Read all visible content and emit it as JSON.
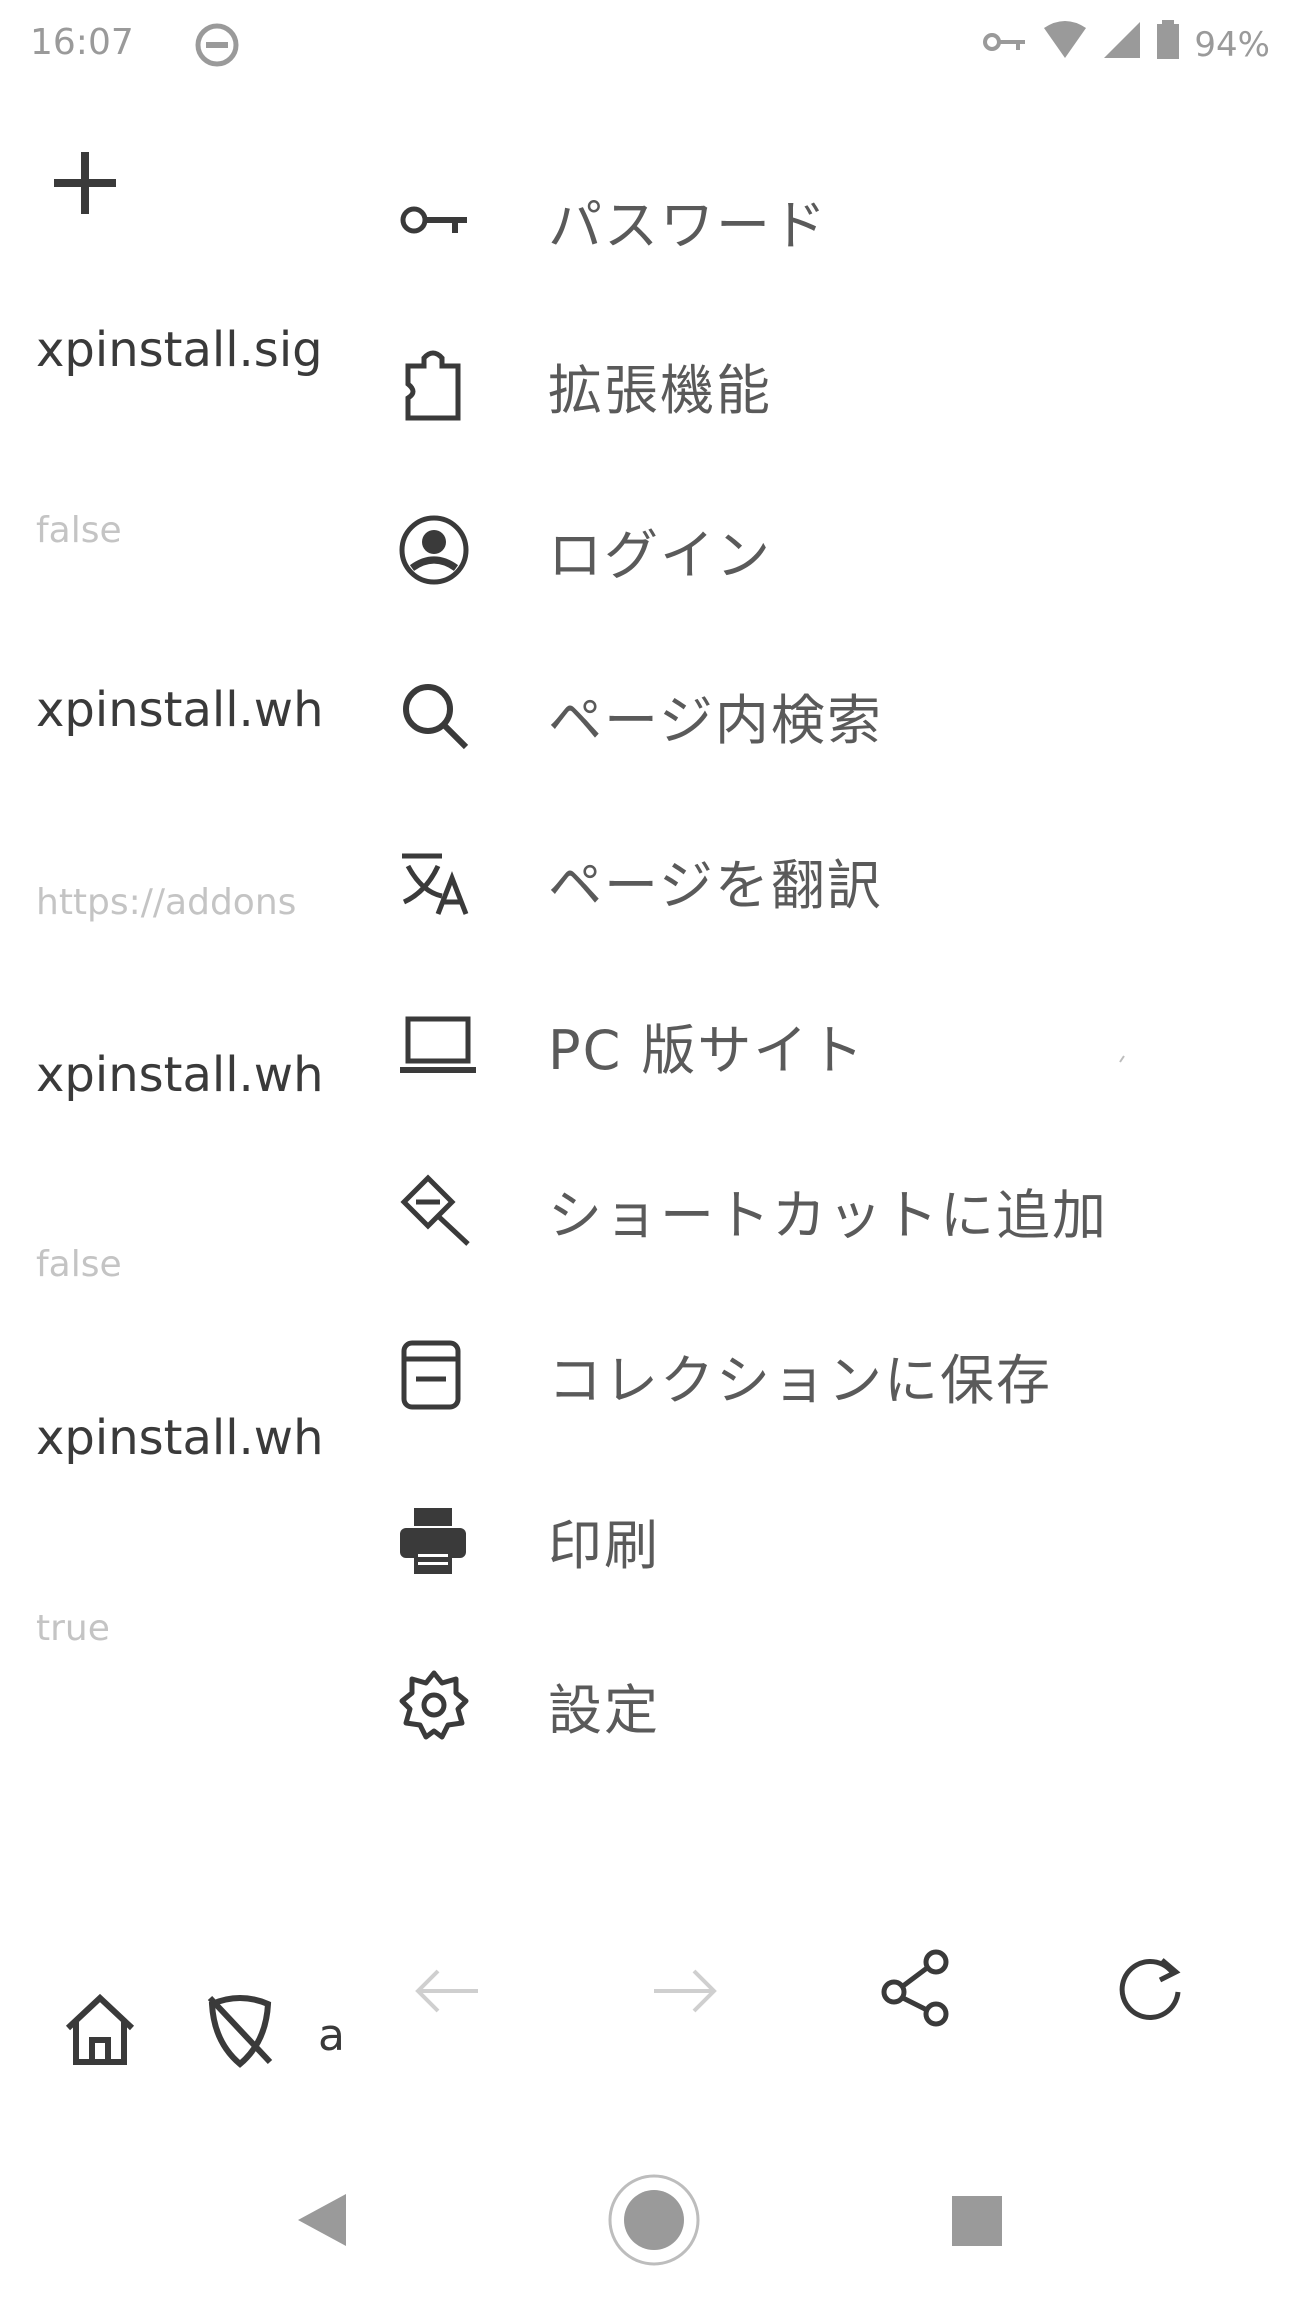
{
  "status_bar": {
    "time": "16:07",
    "battery": "94%",
    "icons": [
      "dnd-icon",
      "key-icon",
      "wifi-icon",
      "signal-icon",
      "battery-icon"
    ]
  },
  "background_page": {
    "add_icon": "plus-icon",
    "rows": [
      {
        "text": "xpinstall.sig",
        "kind": "name"
      },
      {
        "text": "false",
        "kind": "value"
      },
      {
        "text": "xpinstall.wh",
        "kind": "name"
      },
      {
        "text": "https://addons",
        "kind": "value"
      },
      {
        "text": "xpinstall.wh",
        "kind": "name"
      },
      {
        "text": "false",
        "kind": "value"
      },
      {
        "text": "xpinstall.wh",
        "kind": "name"
      },
      {
        "text": "true",
        "kind": "value"
      }
    ],
    "bottom_icons": [
      "home-icon",
      "tracking-protection-icon"
    ],
    "bottom_fragment": "a"
  },
  "menu": {
    "items": [
      {
        "label": "パスワード",
        "icon": "key-icon"
      },
      {
        "label": "拡張機能",
        "icon": "extensions-icon"
      },
      {
        "label": "ログイン",
        "icon": "account-icon"
      },
      {
        "label": "ページ内検索",
        "icon": "search-icon"
      },
      {
        "label": "ページを翻訳",
        "icon": "translate-icon"
      },
      {
        "label": "PC 版サイト",
        "icon": "desktop-icon"
      },
      {
        "label": "ショートカットに追加",
        "icon": "add-shortcut-icon"
      },
      {
        "label": "コレクションに保存",
        "icon": "collection-icon"
      },
      {
        "label": "印刷",
        "icon": "print-icon"
      },
      {
        "label": "設定",
        "icon": "settings-icon"
      }
    ],
    "toolbar": [
      "back-icon",
      "forward-icon",
      "share-icon",
      "reload-icon"
    ]
  },
  "nav_bar": [
    "nav-back-icon",
    "nav-home-icon",
    "nav-recents-icon"
  ],
  "colors": {
    "text": "#5a5a5a",
    "icon": "#3a3a3a",
    "dim": "#c8c8c8"
  }
}
